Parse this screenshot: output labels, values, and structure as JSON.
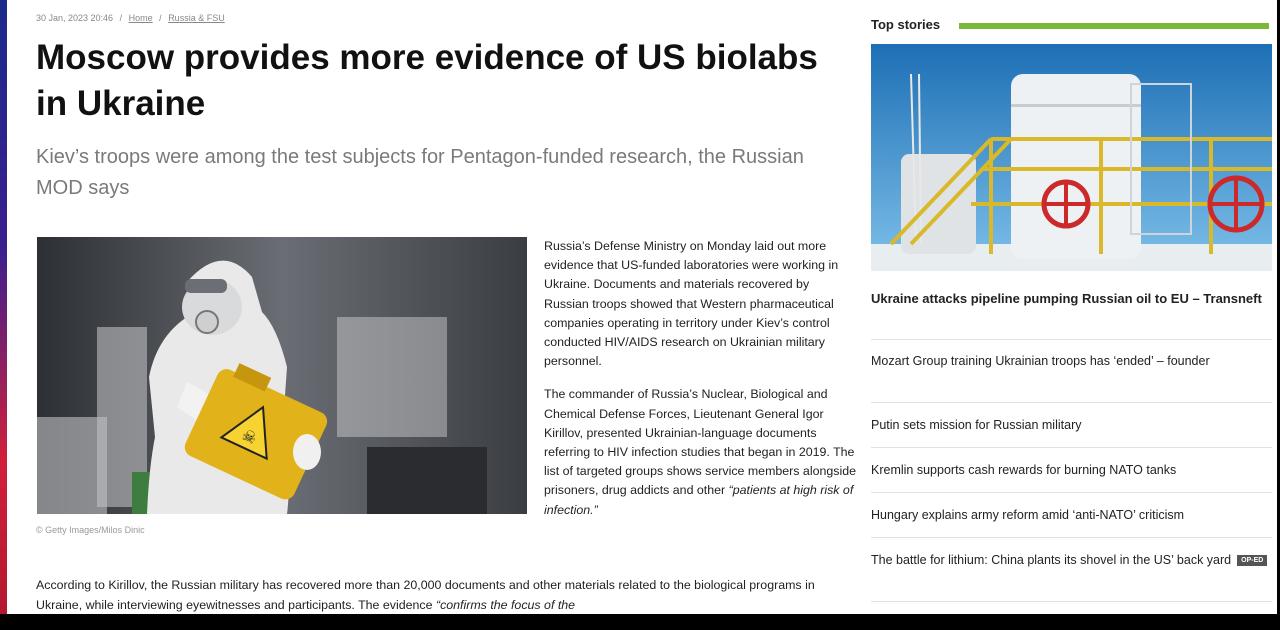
{
  "article": {
    "date": "30 Jan, 2023 20:46",
    "sep": "/",
    "crumb_home": "Home",
    "crumb_section": "Russia & FSU",
    "title": "Moscow provides more evidence of US biolabs in Ukraine",
    "subtitle": "Kiev’s troops were among the test subjects for Pentagon-funded research, the Russian MOD says",
    "photo_credit": "© Getty Images/Milos Dinic",
    "side_paragraph_1": "Russia’s Defense Ministry on Monday laid out more evidence that US-funded laboratories were working in Ukraine. Documents and materials recovered by Russian troops showed that Western pharmaceutical companies operating in territory under Kiev’s control conducted HIV/AIDS research on Ukrainian military personnel.",
    "side_paragraph_2": "The commander of Russia’s Nuclear, Biological and Chemical Defense Forces, Lieutenant General Igor Kirillov, presented Ukrainian-language documents referring to HIV infection studies that began in 2019. The list of targeted groups shows service members alongside prisoners, drug addicts and other",
    "side_paragraph_2_quote": "“patients at high risk of infection.”",
    "body_text": "According to Kirillov, the Russian military has recovered more than 20,000 documents and other materials related to the biological programs in Ukraine, while interviewing eyewitnesses and participants. The evidence",
    "body_quote": "“confirms the focus of the"
  },
  "top_stories": {
    "header": "Top stories",
    "items": [
      {
        "title": "Ukraine attacks pipeline pumping Russian oil to EU – Transneft"
      },
      {
        "title": "Mozart Group training Ukrainian troops has ‘ended’ – founder"
      },
      {
        "title": "Putin sets mission for Russian military"
      },
      {
        "title": "Kremlin supports cash rewards for burning NATO tanks"
      },
      {
        "title": "Hungary explains army reform amid ‘anti-NATO’ criticism"
      },
      {
        "title": "The battle for lithium: China plants its shovel in the US’ back yard",
        "badge": "OP-ED"
      }
    ]
  },
  "colors": {
    "accent_green": "#7ab83a",
    "title_text": "#111111",
    "subtitle_text": "#7a7a7a"
  }
}
